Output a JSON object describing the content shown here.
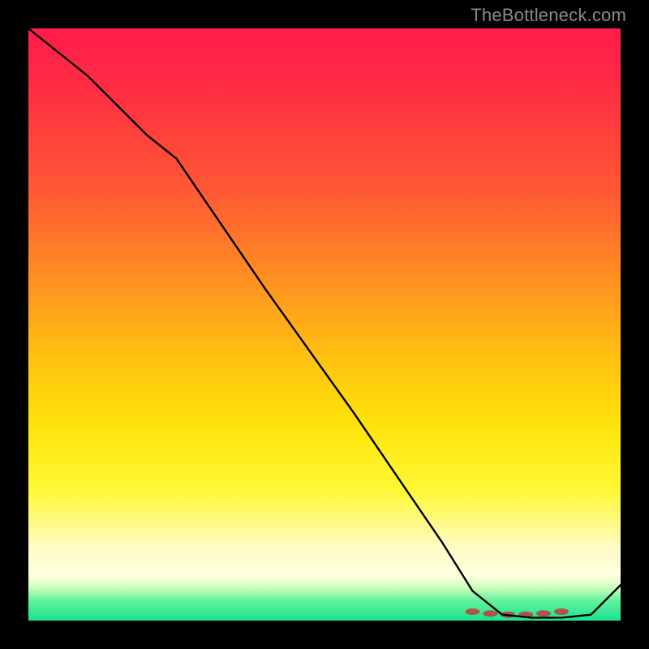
{
  "watermark": "TheBottleneck.com",
  "chart_data": {
    "type": "line",
    "title": "",
    "xlabel": "",
    "ylabel": "",
    "xlim": [
      0,
      100
    ],
    "ylim": [
      0,
      100
    ],
    "grid": false,
    "series": [
      {
        "name": "curve",
        "x": [
          0,
          10,
          20,
          25,
          40,
          55,
          70,
          75,
          80,
          85,
          90,
          95,
          100
        ],
        "y": [
          100,
          92,
          82,
          78,
          56,
          35,
          13,
          5,
          1,
          0.5,
          0.5,
          1,
          6
        ]
      }
    ],
    "markers": {
      "name": "highlight-band",
      "x": [
        75,
        78,
        81,
        84,
        87,
        90
      ],
      "y": [
        1.5,
        1.2,
        1.0,
        1.0,
        1.2,
        1.5
      ],
      "color": "#c13b3b"
    },
    "background_gradient": {
      "stops": [
        {
          "pos": 0.0,
          "color": "#ff1c4b"
        },
        {
          "pos": 0.28,
          "color": "#ff5a34"
        },
        {
          "pos": 0.55,
          "color": "#ffbf12"
        },
        {
          "pos": 0.78,
          "color": "#fff835"
        },
        {
          "pos": 0.92,
          "color": "#fdffe0"
        },
        {
          "pos": 0.97,
          "color": "#66f29e"
        },
        {
          "pos": 1.0,
          "color": "#18e38f"
        }
      ]
    }
  }
}
